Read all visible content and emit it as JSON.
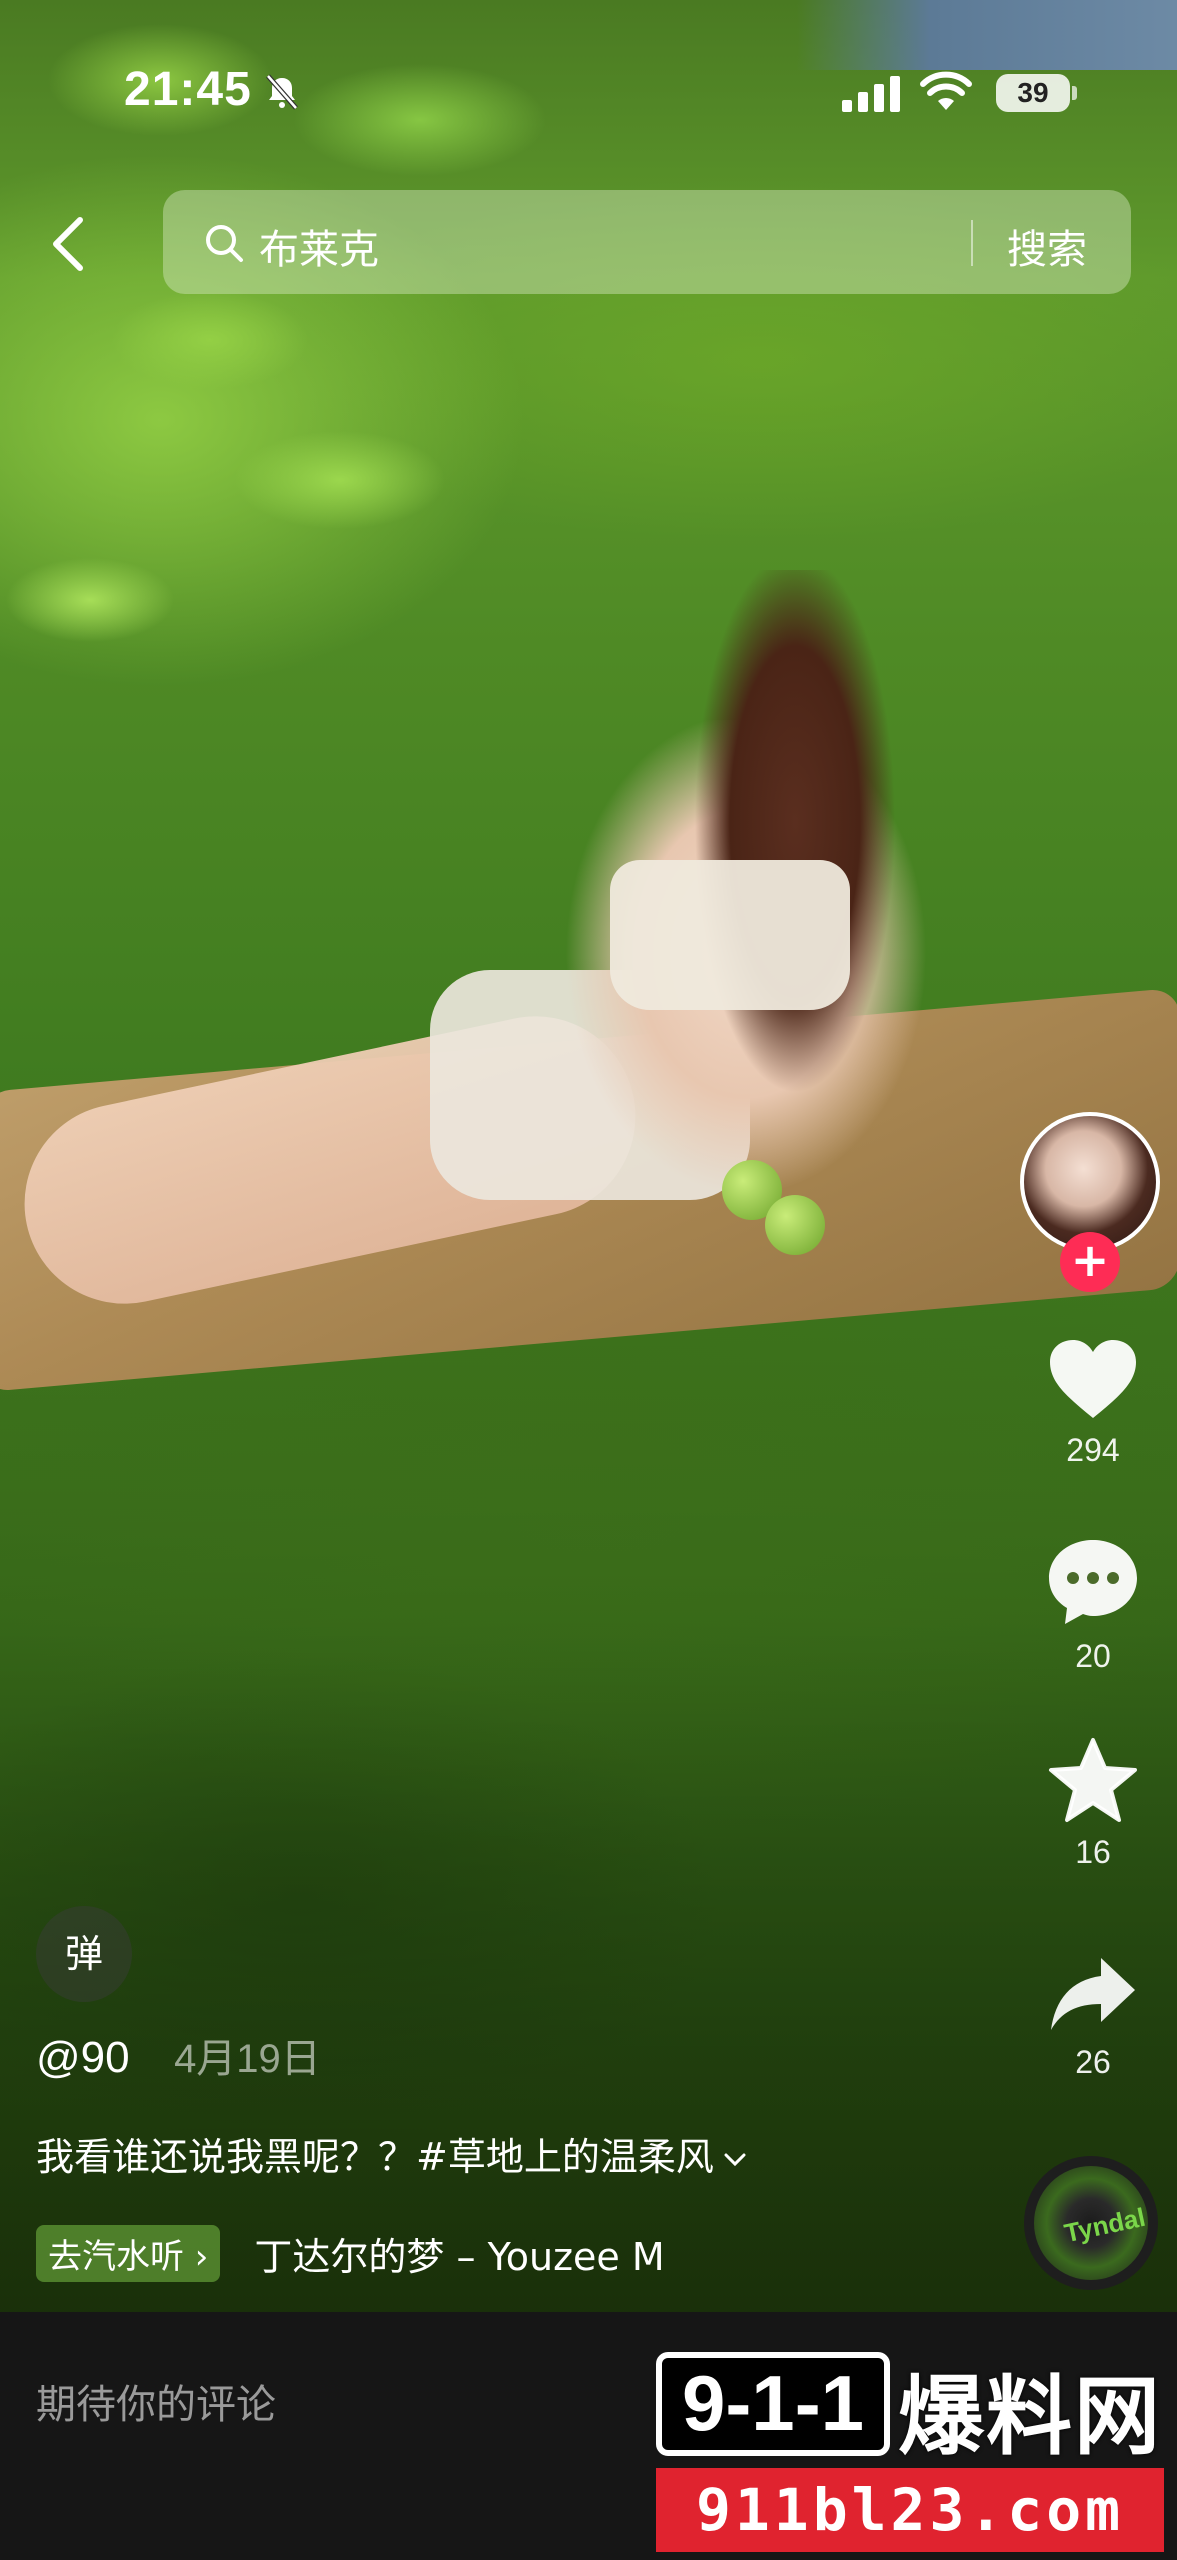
{
  "status_bar": {
    "time": "21:45",
    "battery": "39",
    "icons": [
      "bell-off-icon",
      "signal-icon",
      "wifi-icon",
      "battery-icon"
    ]
  },
  "search": {
    "query": "布莱克",
    "button_label": "搜索",
    "back_icon": "chevron-left-icon"
  },
  "actions": {
    "likes": "294",
    "comments": "20",
    "favorites": "16",
    "shares": "26",
    "follow_glyph": "+"
  },
  "post": {
    "danmu_label": "弹",
    "author": "@90",
    "date": "4月19日",
    "caption": "我看谁还说我黑呢？？",
    "hashtag": "#草地上的温柔风",
    "music_tag": "去汽水听 ›",
    "music_title": "丁达尔的梦 – Youzee M",
    "disc_label": "Tyndal"
  },
  "comment_bar": {
    "placeholder": "期待你的评论"
  },
  "watermark": {
    "box_text": "9-1-1",
    "title": "爆料网",
    "url": "911bl23.com"
  },
  "colors": {
    "follow_red": "#fe2c55",
    "watermark_red": "#e0232f",
    "comment_bar_bg": "#161616"
  }
}
